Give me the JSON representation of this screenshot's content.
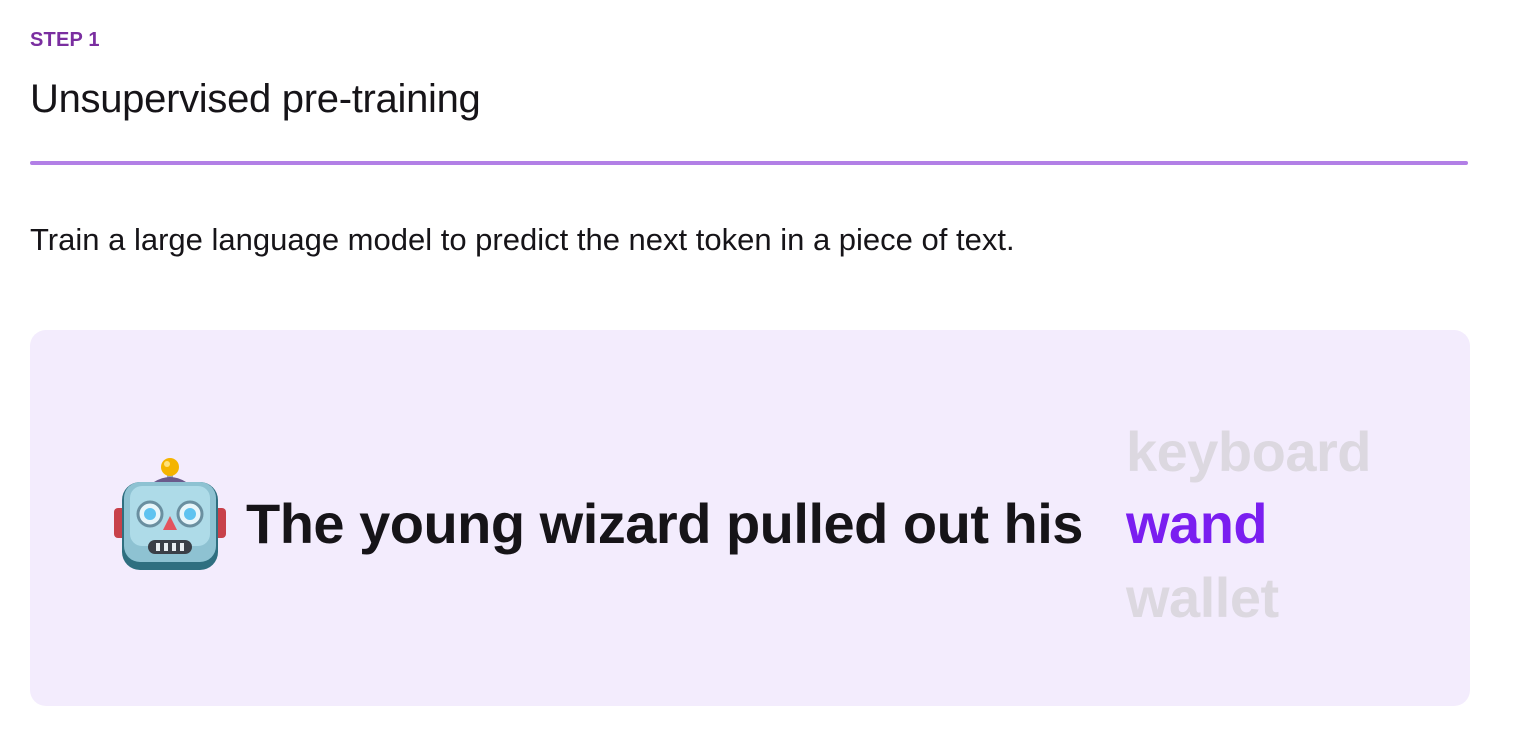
{
  "step": {
    "label": "STEP 1",
    "title": "Unsupervised pre-training",
    "description": "Train a large language model to predict the next token in a piece of text."
  },
  "illustration": {
    "icon": "robot-face-icon",
    "sentence": "The young wizard pulled out his",
    "candidate_tokens": [
      "keyboard",
      "wand",
      "wallet"
    ],
    "predicted_token": "wand"
  },
  "colors": {
    "accent_purple": "#7a2ea0",
    "divider": "#b27fe6",
    "card_background": "#f3ecfd",
    "predicted_token": "#7a1ef0",
    "faded_token": "#dcd8e0",
    "text": "#161418"
  }
}
